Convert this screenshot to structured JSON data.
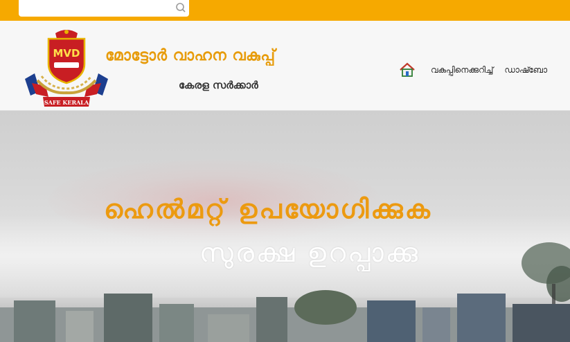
{
  "search": {
    "placeholder": "",
    "value": ""
  },
  "header": {
    "logo_text": "MVD",
    "logo_ribbon": "SAFE KERALA",
    "department": "മോട്ടോർ വാഹന വകുപ്പ്",
    "government": "കേരള സർക്കാർ"
  },
  "nav": {
    "items": [
      {
        "label": "വകുപ്പിനെക്കുറിച്ച്"
      },
      {
        "label": "ഡാഷ്ബോ"
      }
    ]
  },
  "hero": {
    "line1": "ഹെൽമറ്റ് ഉപയോഗിക്കുക",
    "line2": "സുരക്ഷ ഉറപ്പാക്കു"
  },
  "colors": {
    "topbar": "#f6a900",
    "accent_orange": "#ec9a10",
    "header_bg": "#f7f7f7"
  },
  "icons": [
    "search-icon",
    "home-icon"
  ]
}
